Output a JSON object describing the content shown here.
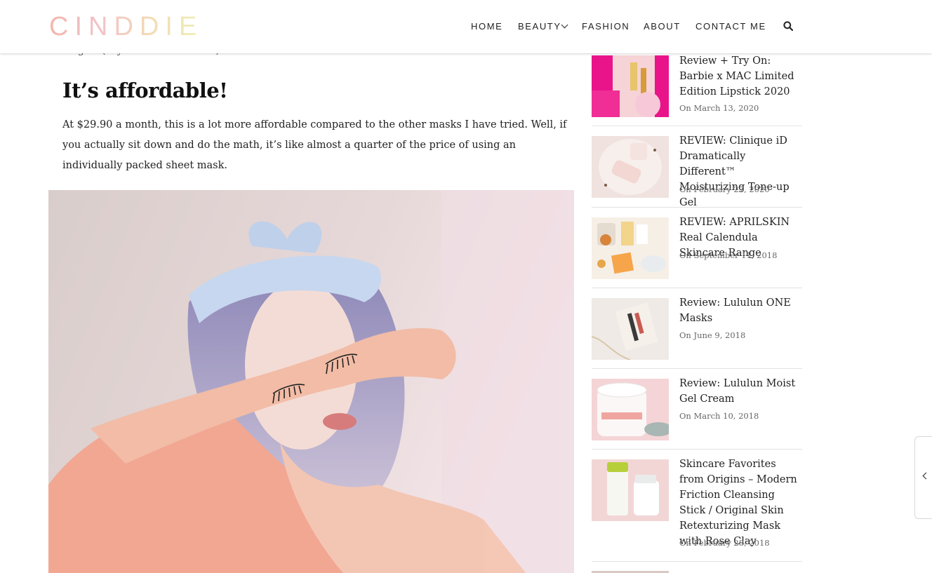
{
  "brand": {
    "logo_text": "CINDDIE"
  },
  "nav": {
    "home": "HOME",
    "beauty": "BEAUTY",
    "fashion": "FASHION",
    "about": "ABOUT",
    "contact": "CONTACT ME"
  },
  "article": {
    "clipped_line": "longer! (Yay to more moisture!)",
    "heading": "It’s affordable!",
    "paragraph": "At $29.90 a month, this is a lot more affordable compared to the other masks I have tried. Well, if you actually sit down and do the math, it’s like almost a quarter of the price of using an individually packed sheet mask."
  },
  "sidebar": {
    "posts": [
      {
        "title": "Review + Try On: Barbie x MAC Limited Edition Lipstick 2020",
        "date": "On March 13, 2020"
      },
      {
        "title": "REVIEW: Clinique iD Dramatically Different™ Moisturizing Tone-up Gel",
        "date": "On February 27, 2020"
      },
      {
        "title": "REVIEW: APRILSKIN Real Calendula Skincare Range",
        "date": "On September 11, 2018"
      },
      {
        "title": "Review: Lululun ONE Masks",
        "date": "On June 9, 2018"
      },
      {
        "title": "Review: Lululun Moist Gel Cream",
        "date": "On March 10, 2018"
      },
      {
        "title": "Skincare Favorites from Origins – Modern Friction Cleansing Stick / Original Skin Retexturizing Mask with Rose Clay",
        "date": "On February 28, 2018"
      }
    ]
  },
  "colors": {
    "accent_pink": "#e9148a",
    "text": "#222222",
    "date": "#666666"
  },
  "icons": {
    "search": "search-icon",
    "beauty_dropdown": "chevron-down-icon",
    "side_toggle": "chevron-left-icon"
  }
}
